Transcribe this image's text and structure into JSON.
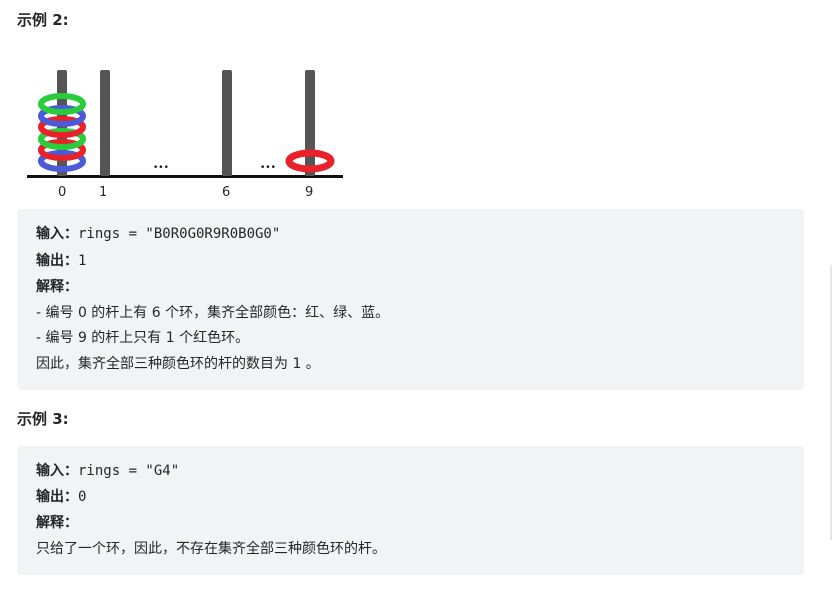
{
  "example2": {
    "heading": "示例 2:",
    "figure": {
      "rod_labels": [
        "0",
        "1",
        "6",
        "9"
      ],
      "ellipsis": "•••",
      "rod0_rings_bottom_to_top": [
        "blue",
        "red",
        "green",
        "red",
        "blue",
        "green"
      ],
      "rod9_rings": [
        "red"
      ],
      "colors": {
        "red": "#e8212a",
        "green": "#29cc3a",
        "blue": "#4a5ad9",
        "rod": "#555555",
        "base": "#111111"
      }
    },
    "input_label": "输入：",
    "input_value": "rings = \"B0R0G0R9R0B0G0\"",
    "output_label": "输出：",
    "output_value": "1",
    "explain_label": "解释：",
    "explain_lines": [
      "- 编号 0 的杆上有 6 个环，集齐全部颜色：红、绿、蓝。",
      "- 编号 9 的杆上只有 1 个红色环。",
      "因此，集齐全部三种颜色环的杆的数目为 1 。"
    ]
  },
  "example3": {
    "heading": "示例 3:",
    "input_label": "输入：",
    "input_value": "rings = \"G4\"",
    "output_label": "输出：",
    "output_value": "0",
    "explain_label": "解释：",
    "explain_lines": [
      "只给了一个环，因此，不存在集齐全部三种颜色环的杆。"
    ]
  }
}
